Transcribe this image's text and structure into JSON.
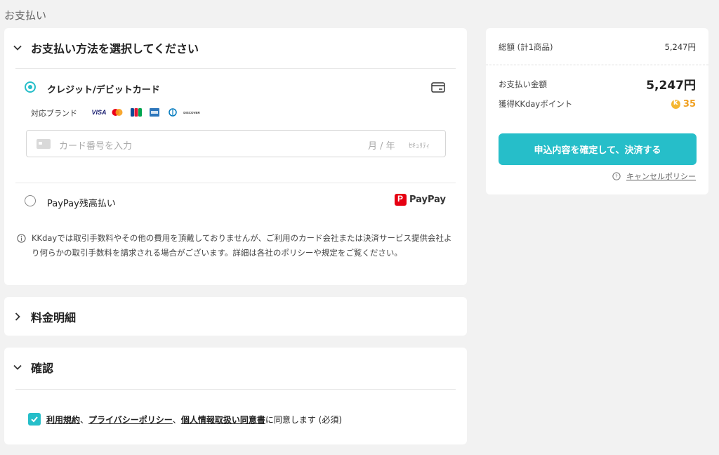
{
  "page": {
    "heading": "お支払い"
  },
  "payment_section": {
    "title": "お支払い方法を選択してください",
    "credit_card": {
      "label": "クレジット/デビットカード",
      "selected": true,
      "brands_label": "対応ブランド",
      "brands": [
        "VISA",
        "Mastercard",
        "JCB",
        "AMEX",
        "Diners",
        "DISCOVER"
      ],
      "card_number_placeholder": "カード番号を入力",
      "expiry_placeholder": "月 / 年",
      "security_placeholder": "ｾｷｭﾘﾃｨ"
    },
    "paypay": {
      "label": "PayPay残高払い",
      "selected": false,
      "logo_text": "PayPay"
    },
    "notice": "KKdayでは取引手数料やその他の費用を頂戴しておりませんが、ご利用のカード会社または決済サービス提供会社より何らかの取引手数料を請求される場合がございます。詳細は各社のポリシーや規定をご覧ください。"
  },
  "fees_section": {
    "title": "料金明細"
  },
  "confirm_section": {
    "title": "確認",
    "checked": true,
    "links": [
      "利用規約",
      "プライバシーポリシー",
      "個人情報取扱い同意書"
    ],
    "separator": "、",
    "suffix": "に同意します (必須)"
  },
  "summary": {
    "total_label": "総額 (計1商品)",
    "total_value": "5,247円",
    "pay_label": "お支払い金額",
    "pay_value": "5,247円",
    "points_label": "獲得KKdayポイント",
    "points_value": "35",
    "submit_button": "申込内容を確定して、決済する",
    "cancel_policy": "キャンセルポリシー"
  },
  "colors": {
    "accent": "#26bec9",
    "points": "#f0a020",
    "paypay": "#e60012"
  }
}
